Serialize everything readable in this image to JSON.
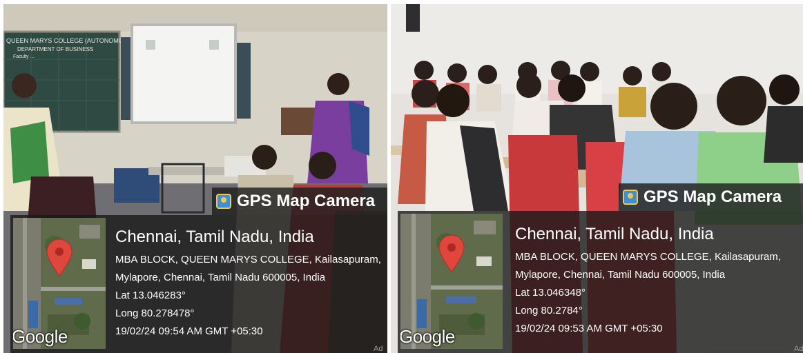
{
  "photos": [
    {
      "gps": {
        "brand": "GPS Map Camera",
        "city": "Chennai, Tamil Nadu, India",
        "address_line1": "MBA BLOCK, QUEEN MARYS COLLEGE, Kailasapuram,",
        "address_line2": "Mylapore, Chennai, Tamil Nadu 600005, India",
        "lat": "Lat 13.046283°",
        "long": "Long 80.278478°",
        "datetime": "19/02/24 09:54 AM GMT +05:30",
        "map_logo": "Google"
      },
      "board_text": [
        "QUEEN MARYS COLLEGE (AUTONOMOUS)",
        "DEPARTMENT OF BUSINESS",
        "Faculty ..."
      ],
      "ad_label": "Ad"
    },
    {
      "gps": {
        "brand": "GPS Map Camera",
        "city": "Chennai, Tamil Nadu, India",
        "address_line1": "MBA BLOCK, QUEEN MARYS COLLEGE, Kailasapuram,",
        "address_line2": "Mylapore, Chennai, Tamil Nadu 600005, India",
        "lat": "Lat 13.046348°",
        "long": "Long 80.2784°",
        "datetime": "19/02/24 09:53 AM GMT +05:30",
        "map_logo": "Google"
      },
      "ad_label": "Ad"
    }
  ],
  "colors": {
    "overlay": "#1e1e1e",
    "pin": "#e0463b",
    "logo_icon": "#3f8ed8"
  },
  "icons": [
    "location-pin-icon",
    "gps-camera-icon"
  ]
}
